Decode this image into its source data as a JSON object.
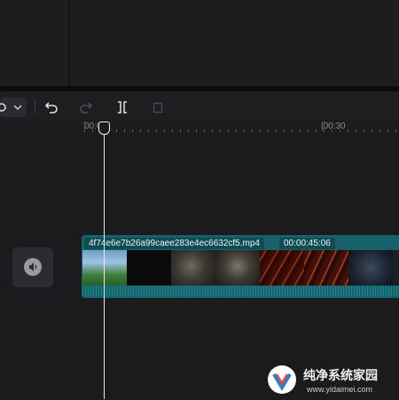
{
  "toolbar": {
    "icons": [
      "gear-icon",
      "chevron-down-icon",
      "undo-icon",
      "redo-icon",
      "split-icon",
      "delete-icon"
    ]
  },
  "ruler": {
    "start_label": "00:00",
    "mark_label": "|00:30"
  },
  "clip": {
    "filename": "4f74e6e7b26a99caee283e4ec6632cf5.mp4",
    "duration": "00:00:45:06"
  },
  "watermark": {
    "title": "纯净系统家园",
    "url": "www.yidaimei.com"
  },
  "colors": {
    "clip_teal": "#15626a",
    "playhead": "#e9e9e9",
    "background": "#1b1b1d"
  }
}
